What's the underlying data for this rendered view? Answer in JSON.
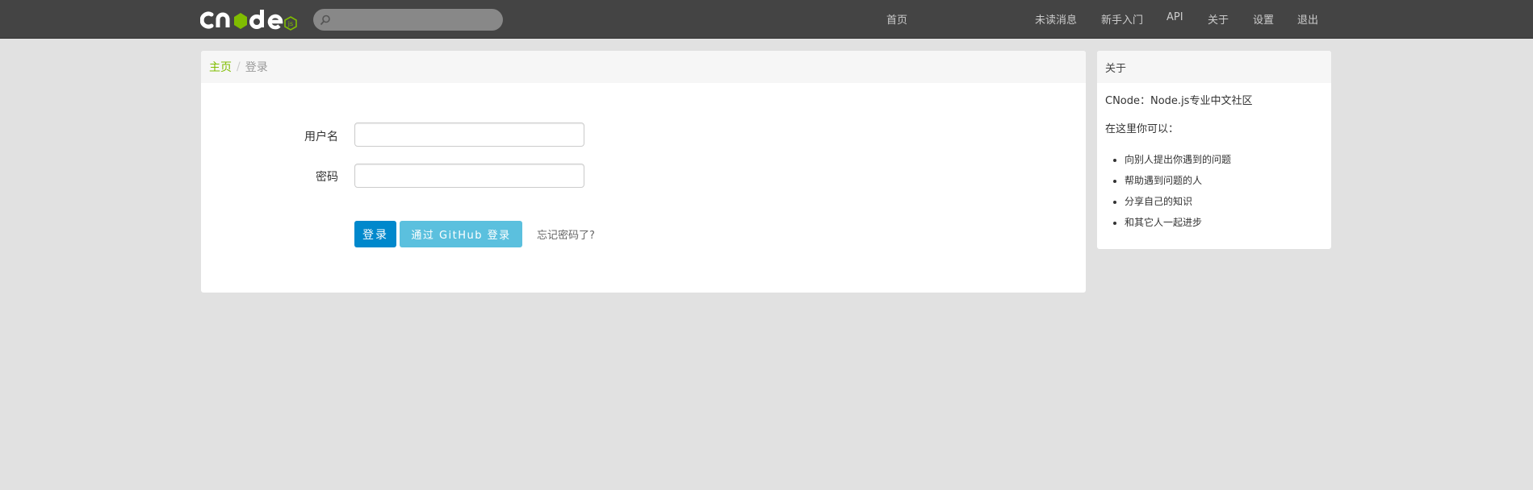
{
  "navbar": {
    "brand": "cnode",
    "brand_badge": "js",
    "search_placeholder": "",
    "links": [
      {
        "label": "首页"
      },
      {
        "label": "未读消息"
      },
      {
        "label": "新手入门"
      },
      {
        "label": "API"
      },
      {
        "label": "关于"
      },
      {
        "label": "设置"
      },
      {
        "label": "退出"
      }
    ]
  },
  "breadcrumb": {
    "home": "主页",
    "divider": "/",
    "current": "登录"
  },
  "login_form": {
    "username_label": "用户名",
    "username_value": "",
    "password_label": "密码",
    "password_value": "",
    "login_button": "登录",
    "github_button": "通过 GitHub 登录",
    "forgot_link": "忘记密码了?"
  },
  "sidebar": {
    "title": "关于",
    "intro": "CNode：Node.js专业中文社区",
    "subtitle": "在这里你可以：",
    "items": [
      "向别人提出你遇到的问题",
      "帮助遇到问题的人",
      "分享自己的知识",
      "和其它人一起进步"
    ]
  },
  "colors": {
    "navbar_bg": "#444444",
    "accent_green": "#80bd01",
    "button_primary": "#0088cc",
    "button_info": "#5bc0de"
  }
}
